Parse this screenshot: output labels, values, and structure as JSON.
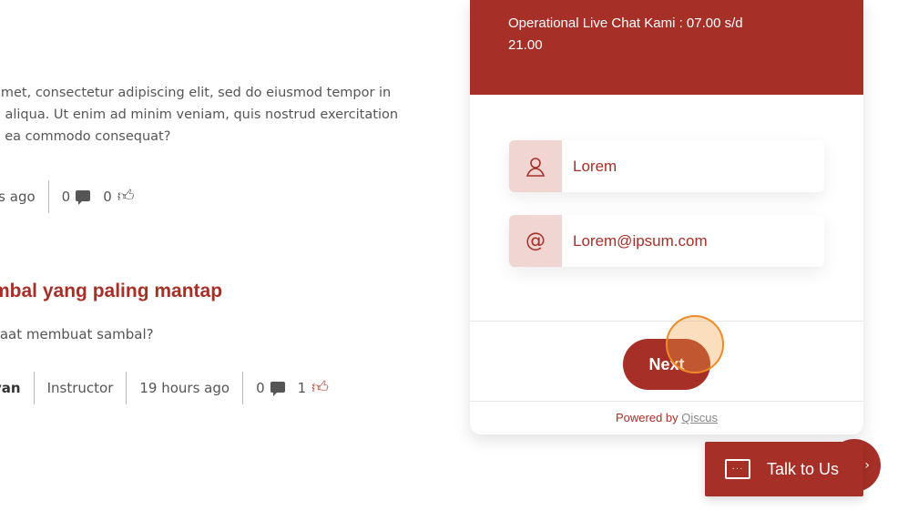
{
  "forum": {
    "post1": {
      "body_lines": [
        "amet, consectetur adipiscing elit, sed do eiusmod tempor in",
        "a aliqua. Ut enim ad minim veniam, quis nostrud exercitation",
        "x ea commodo consequat?"
      ],
      "time": "rs ago",
      "comments": "0",
      "likes": "0"
    },
    "post2": {
      "title": "mbal yang paling mantap",
      "body": "saat membuat sambal?",
      "author": "yan",
      "role": "Instructor",
      "time": "19 hours ago",
      "comments": "0",
      "likes": "1"
    }
  },
  "chat_widget": {
    "header_line1": "Operational Live Chat Kami : 07.00 s/d",
    "header_line2": "21.00",
    "name_value": "Lorem",
    "email_value": "Lorem@ipsum.com",
    "next_label": "Next",
    "powered_prefix": "Powered by",
    "powered_link": "Qiscus",
    "accent_color": "#a63027"
  },
  "launcher": {
    "label": "Talk to Us"
  },
  "icons": {
    "name_field": "user-icon",
    "email_field": "at-icon",
    "comment": "comment-icon",
    "like": "thumbs-up-icon",
    "chat": "chat-icon"
  }
}
